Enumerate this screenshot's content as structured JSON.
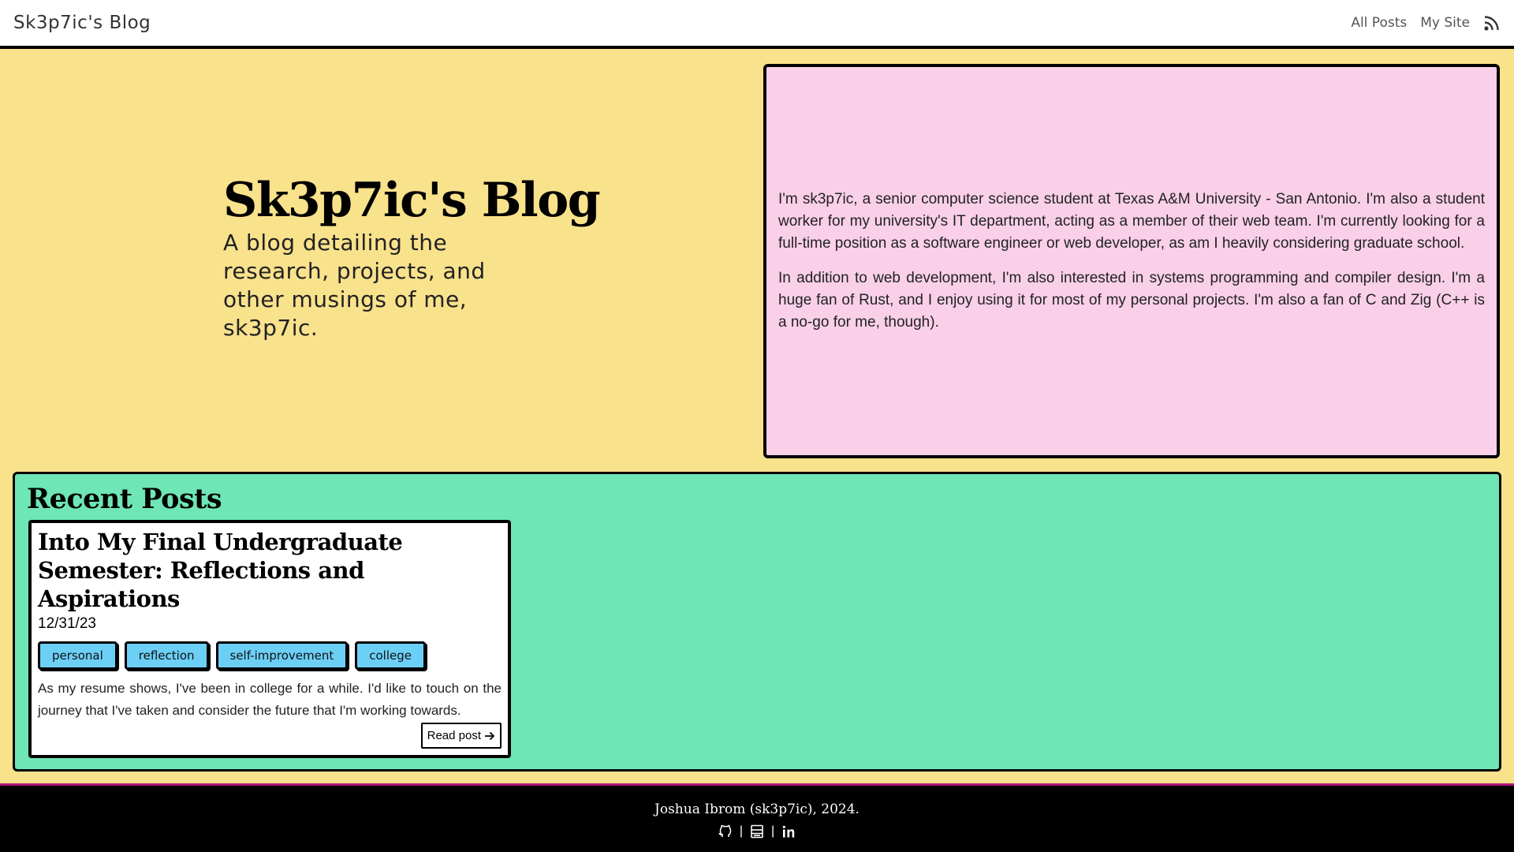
{
  "nav": {
    "brand": "Sk3p7ic's Blog",
    "links": [
      "All Posts",
      "My Site"
    ],
    "rss_icon": "rss-icon"
  },
  "hero": {
    "title": "Sk3p7ic's Blog",
    "subtitle": "A blog detailing the research, projects, and other musings of me, sk3p7ic."
  },
  "about": {
    "paragraphs": [
      "I'm sk3p7ic, a senior computer science student at Texas A&M University - San Antonio. I'm also a student worker for my university's IT department, acting as a member of their web team. I'm currently looking for a full-time position as a software engineer or web developer, as am I heavily considering graduate school.",
      "In addition to web development, I'm also interested in systems programming and compiler design. I'm a huge fan of Rust, and I enjoy using it for most of my personal projects. I'm also a fan of C and Zig (C++ is a no-go for me, though)."
    ]
  },
  "recent": {
    "title": "Recent Posts",
    "posts": [
      {
        "title": "Into My Final Undergraduate Semester: Reflections and Aspirations",
        "date": "12/31/23",
        "tags": [
          "personal",
          "reflection",
          "self-improvement",
          "college"
        ],
        "excerpt": "As my resume shows, I've been in college for a while. I'd like to touch on the journey that I've taken and consider the future that I'm working towards.",
        "read_label": "Read post"
      }
    ]
  },
  "footer": {
    "text": "Joshua Ibrom (sk3p7ic), 2024.",
    "icons": [
      "github-icon",
      "resume-icon",
      "linkedin-icon"
    ]
  },
  "colors": {
    "hero_bg": "#f9e28c",
    "about_bg": "#f9d0e8",
    "recent_bg": "#6ee6b6",
    "tag_bg": "#6ccff6",
    "footer_bg": "#000000",
    "footer_accent": "#b0157f"
  }
}
